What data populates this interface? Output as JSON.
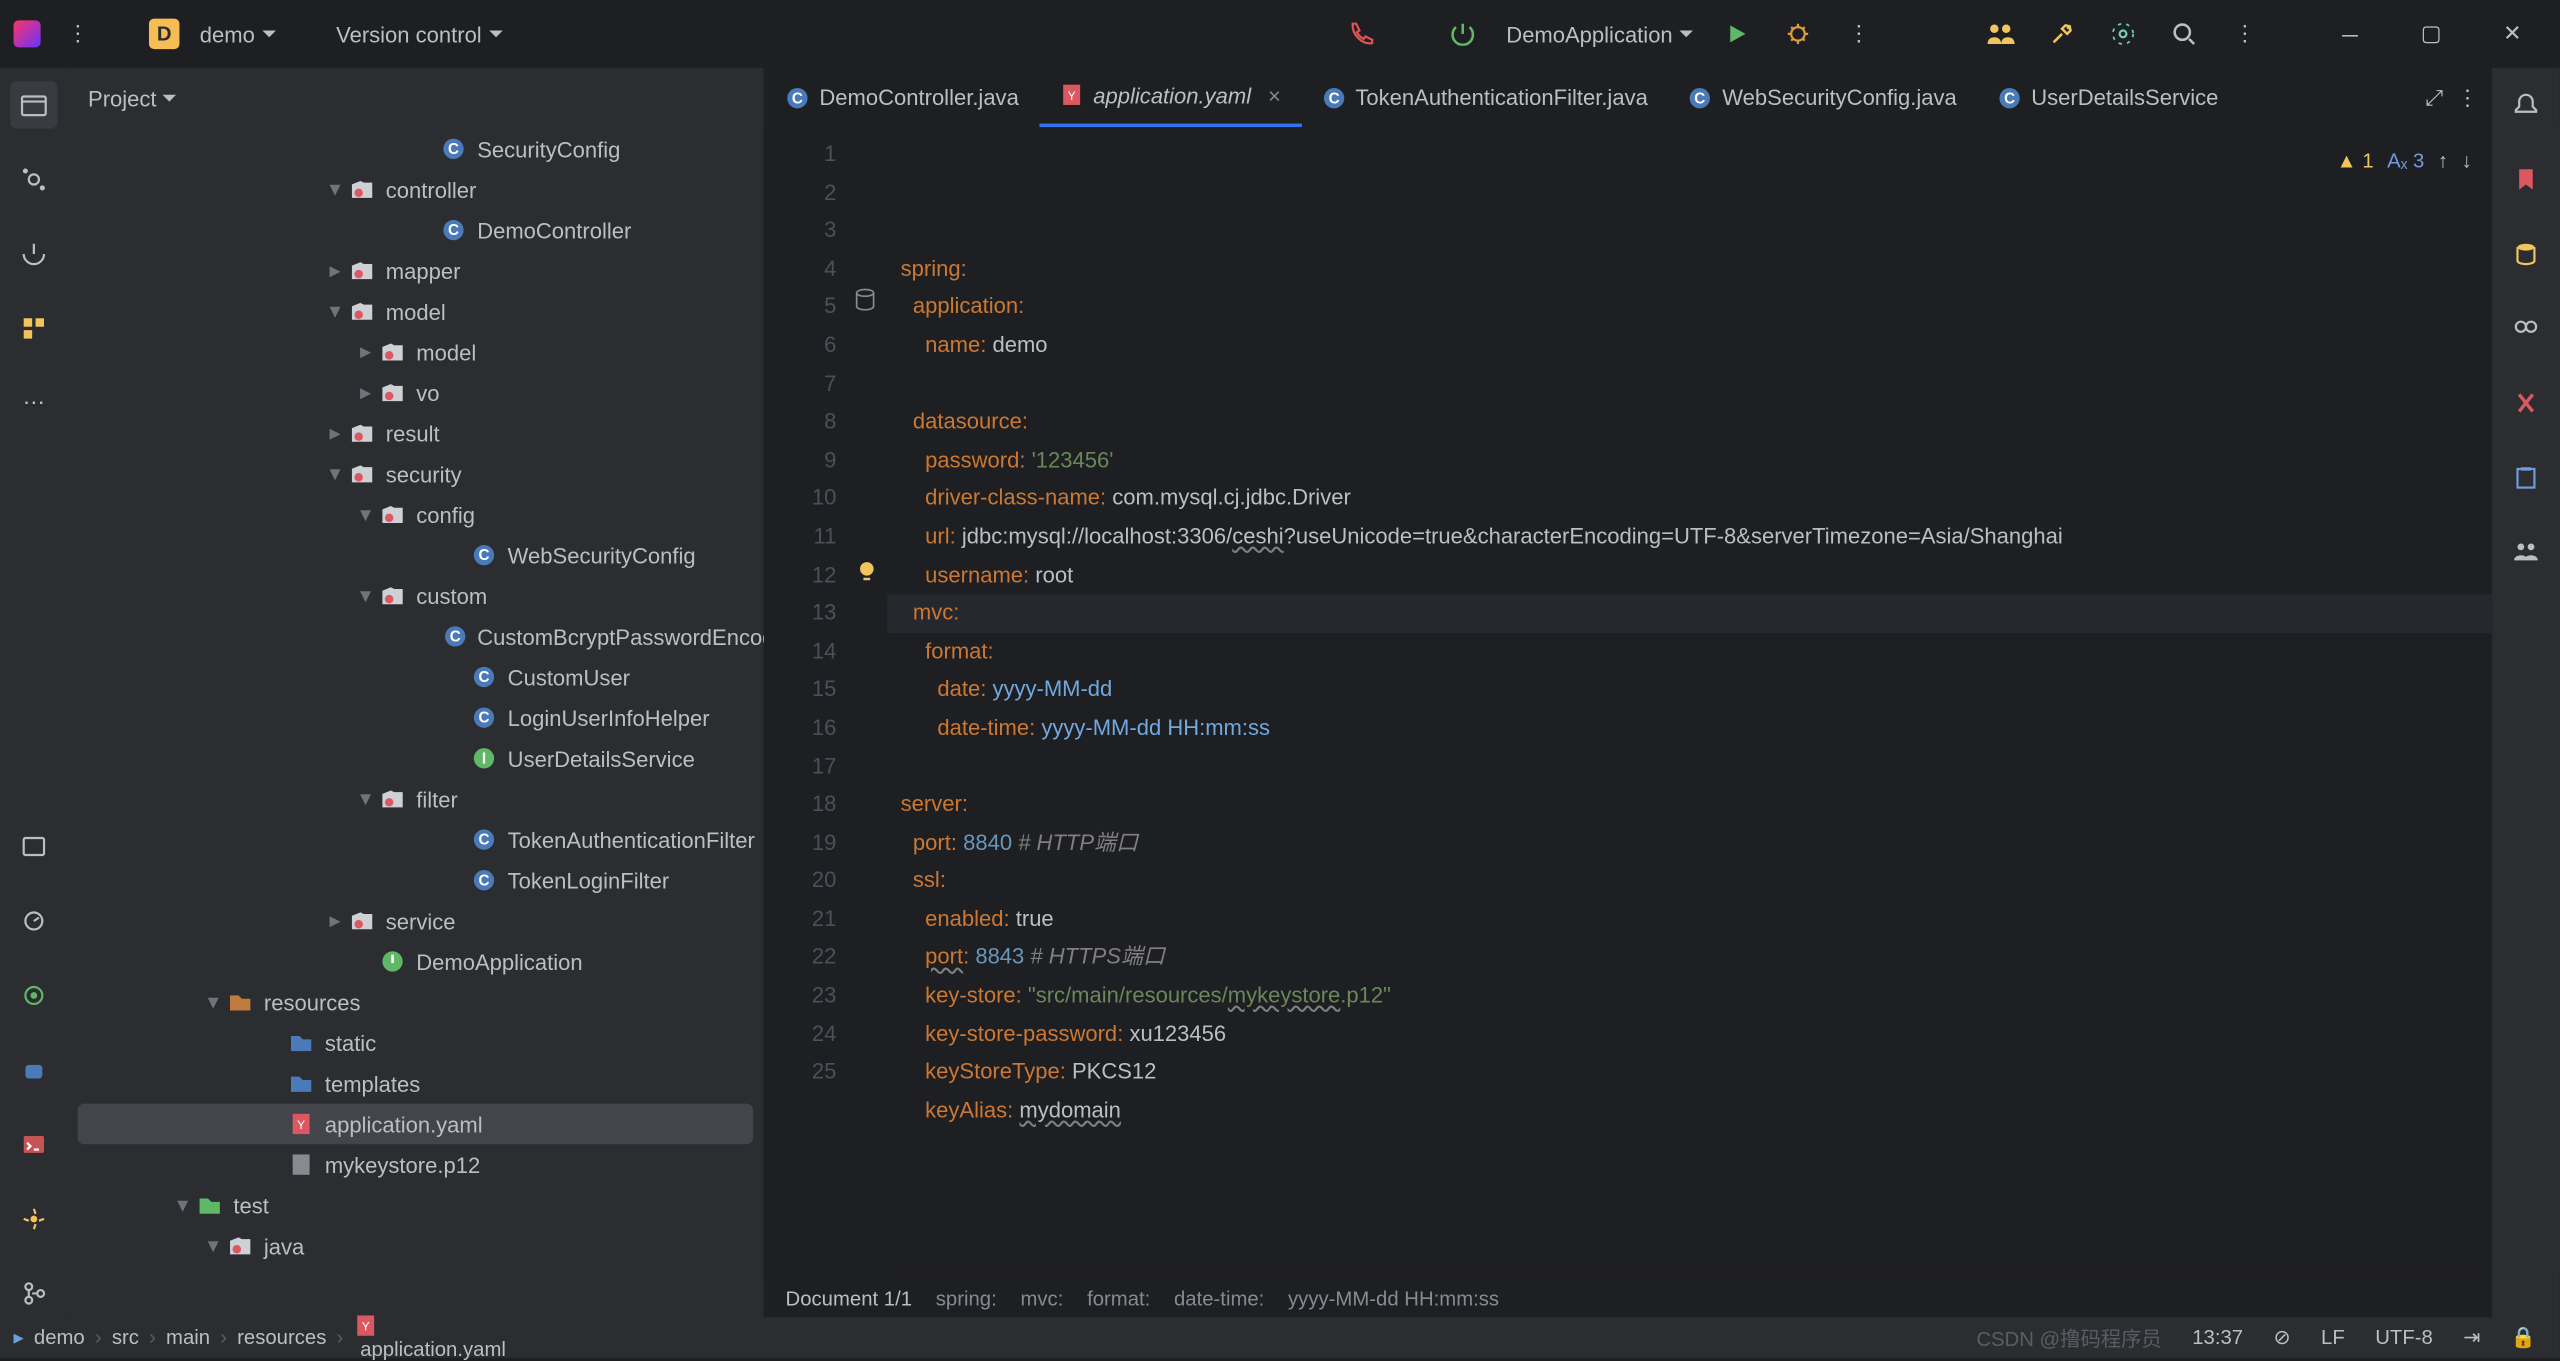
{
  "titlebar": {
    "project_badge": "D",
    "project_name": "demo",
    "vcs_label": "Version control",
    "run_config": "DemoApplication"
  },
  "sidebar": {
    "title": "Project",
    "items": [
      {
        "indent": 204,
        "arrow": "",
        "icon": "class",
        "label": "SecurityConfig"
      },
      {
        "indent": 150,
        "arrow": "▾",
        "icon": "pkg",
        "label": "controller"
      },
      {
        "indent": 204,
        "arrow": "",
        "icon": "class",
        "label": "DemoController"
      },
      {
        "indent": 150,
        "arrow": "▸",
        "icon": "pkg",
        "label": "mapper"
      },
      {
        "indent": 150,
        "arrow": "▾",
        "icon": "pkg",
        "label": "model"
      },
      {
        "indent": 168,
        "arrow": "▸",
        "icon": "pkg",
        "label": "model"
      },
      {
        "indent": 168,
        "arrow": "▸",
        "icon": "pkg",
        "label": "vo"
      },
      {
        "indent": 150,
        "arrow": "▸",
        "icon": "pkg",
        "label": "result"
      },
      {
        "indent": 150,
        "arrow": "▾",
        "icon": "pkg",
        "label": "security"
      },
      {
        "indent": 168,
        "arrow": "▾",
        "icon": "pkg",
        "label": "config"
      },
      {
        "indent": 222,
        "arrow": "",
        "icon": "class",
        "label": "WebSecurityConfig"
      },
      {
        "indent": 168,
        "arrow": "▾",
        "icon": "pkg",
        "label": "custom"
      },
      {
        "indent": 222,
        "arrow": "",
        "icon": "class",
        "label": "CustomBcryptPasswordEncoder"
      },
      {
        "indent": 222,
        "arrow": "",
        "icon": "class",
        "label": "CustomUser"
      },
      {
        "indent": 222,
        "arrow": "",
        "icon": "class",
        "label": "LoginUserInfoHelper"
      },
      {
        "indent": 222,
        "arrow": "",
        "icon": "interface",
        "label": "UserDetailsService"
      },
      {
        "indent": 168,
        "arrow": "▾",
        "icon": "pkg",
        "label": "filter"
      },
      {
        "indent": 222,
        "arrow": "",
        "icon": "class",
        "label": "TokenAuthenticationFilter"
      },
      {
        "indent": 222,
        "arrow": "",
        "icon": "class",
        "label": "TokenLoginFilter"
      },
      {
        "indent": 150,
        "arrow": "▸",
        "icon": "pkg",
        "label": "service"
      },
      {
        "indent": 168,
        "arrow": "",
        "icon": "springboot",
        "label": "DemoApplication"
      },
      {
        "indent": 78,
        "arrow": "▾",
        "icon": "res",
        "label": "resources"
      },
      {
        "indent": 114,
        "arrow": "",
        "icon": "folder",
        "label": "static"
      },
      {
        "indent": 114,
        "arrow": "",
        "icon": "folder",
        "label": "templates"
      },
      {
        "indent": 114,
        "arrow": "",
        "icon": "yaml",
        "label": "application.yaml",
        "selected": true
      },
      {
        "indent": 114,
        "arrow": "",
        "icon": "file",
        "label": "mykeystore.p12"
      },
      {
        "indent": 60,
        "arrow": "▾",
        "icon": "folder-test",
        "label": "test"
      },
      {
        "indent": 78,
        "arrow": "▾",
        "icon": "pkg",
        "label": "java"
      }
    ]
  },
  "tabs": [
    {
      "icon": "class",
      "label": "DemoController.java",
      "active": false
    },
    {
      "icon": "yaml",
      "label": "application.yaml",
      "active": true,
      "italic": true
    },
    {
      "icon": "class",
      "label": "TokenAuthenticationFilter.java",
      "active": false
    },
    {
      "icon": "class",
      "label": "WebSecurityConfig.java",
      "active": false
    },
    {
      "icon": "class",
      "label": "UserDetailsService",
      "active": false
    }
  ],
  "inspection": {
    "warnings": "1",
    "typos": "3"
  },
  "code": {
    "lines": [
      [
        {
          "t": "spring",
          "c": "k-key"
        },
        {
          "t": ":",
          "c": "k-key"
        }
      ],
      [
        {
          "t": "  "
        },
        {
          "t": "application",
          "c": "k-key"
        },
        {
          "t": ":",
          "c": "k-key"
        }
      ],
      [
        {
          "t": "    "
        },
        {
          "t": "name",
          "c": "k-key"
        },
        {
          "t": ": ",
          "c": "k-key"
        },
        {
          "t": "demo",
          "c": "k-val"
        }
      ],
      [],
      [
        {
          "t": "  "
        },
        {
          "t": "datasource",
          "c": "k-key"
        },
        {
          "t": ":",
          "c": "k-key"
        }
      ],
      [
        {
          "t": "    "
        },
        {
          "t": "password",
          "c": "k-key"
        },
        {
          "t": ": ",
          "c": "k-key"
        },
        {
          "t": "'123456'",
          "c": "k-str"
        }
      ],
      [
        {
          "t": "    "
        },
        {
          "t": "driver-class-name",
          "c": "k-key"
        },
        {
          "t": ": ",
          "c": "k-key"
        },
        {
          "t": "com.mysql.cj.jdbc.Driver",
          "c": "k-val"
        }
      ],
      [
        {
          "t": "    "
        },
        {
          "t": "url",
          "c": "k-key"
        },
        {
          "t": ": ",
          "c": "k-key"
        },
        {
          "t": "jdbc:mysql://localhost:3306/",
          "c": "k-val"
        },
        {
          "t": "ceshi",
          "c": "k-val k-wavy"
        },
        {
          "t": "?useUnicode=true&characterEncoding=UTF-8&serverTimezone=Asia/Shanghai",
          "c": "k-val"
        }
      ],
      [
        {
          "t": "    "
        },
        {
          "t": "username",
          "c": "k-key"
        },
        {
          "t": ": ",
          "c": "k-key"
        },
        {
          "t": "root",
          "c": "k-val"
        }
      ],
      [
        {
          "t": "  "
        },
        {
          "t": "mvc",
          "c": "k-key"
        },
        {
          "t": ":",
          "c": "k-key"
        }
      ],
      [
        {
          "t": "    "
        },
        {
          "t": "format",
          "c": "k-key"
        },
        {
          "t": ":",
          "c": "k-key"
        }
      ],
      [
        {
          "t": "      "
        },
        {
          "t": "date",
          "c": "k-key"
        },
        {
          "t": ": ",
          "c": "k-key"
        },
        {
          "t": "yyyy-MM-dd",
          "c": "k-ref"
        }
      ],
      [
        {
          "t": "      "
        },
        {
          "t": "date-time",
          "c": "k-key"
        },
        {
          "t": ": ",
          "c": "k-key"
        },
        {
          "t": "yyyy-MM-dd HH:mm:ss",
          "c": "k-ref"
        }
      ],
      [],
      [
        {
          "t": "server",
          "c": "k-key"
        },
        {
          "t": ":",
          "c": "k-key"
        }
      ],
      [
        {
          "t": "  "
        },
        {
          "t": "port",
          "c": "k-key"
        },
        {
          "t": ": ",
          "c": "k-key"
        },
        {
          "t": "8840",
          "c": "k-num"
        },
        {
          "t": " "
        },
        {
          "t": "# HTTP端口",
          "c": "k-cmt"
        }
      ],
      [
        {
          "t": "  "
        },
        {
          "t": "ssl",
          "c": "k-key"
        },
        {
          "t": ":",
          "c": "k-key"
        }
      ],
      [
        {
          "t": "    "
        },
        {
          "t": "enabled",
          "c": "k-key"
        },
        {
          "t": ": ",
          "c": "k-key"
        },
        {
          "t": "true",
          "c": "k-val"
        }
      ],
      [
        {
          "t": "    "
        },
        {
          "t": "port",
          "c": "k-key k-wavy"
        },
        {
          "t": ": ",
          "c": "k-key"
        },
        {
          "t": "8843",
          "c": "k-num"
        },
        {
          "t": " "
        },
        {
          "t": "# HTTPS端口",
          "c": "k-cmt"
        }
      ],
      [
        {
          "t": "    "
        },
        {
          "t": "key-store",
          "c": "k-key"
        },
        {
          "t": ": ",
          "c": "k-key"
        },
        {
          "t": "\"src/main/resources/",
          "c": "k-str"
        },
        {
          "t": "mykeystore",
          "c": "k-str k-wavy"
        },
        {
          "t": ".p12\"",
          "c": "k-str"
        }
      ],
      [
        {
          "t": "    "
        },
        {
          "t": "key-store-password",
          "c": "k-key"
        },
        {
          "t": ": ",
          "c": "k-key"
        },
        {
          "t": "xu123456",
          "c": "k-val"
        }
      ],
      [
        {
          "t": "    "
        },
        {
          "t": "keyStoreType",
          "c": "k-key"
        },
        {
          "t": ": ",
          "c": "k-key"
        },
        {
          "t": "PKCS12",
          "c": "k-val"
        }
      ],
      [
        {
          "t": "    "
        },
        {
          "t": "keyAlias",
          "c": "k-key"
        },
        {
          "t": ": ",
          "c": "k-key"
        },
        {
          "t": "mydomain",
          "c": "k-val k-wavy"
        }
      ],
      [],
      []
    ],
    "highlight_line": 13,
    "lightbulb_line": 12,
    "db_gutter_line": 5
  },
  "breadcrumb_editor": {
    "doc": "Document 1/1",
    "path": [
      "spring:",
      "mvc:",
      "format:",
      "date-time:",
      "yyyy-MM-dd HH:mm:ss"
    ]
  },
  "nav_path": [
    "demo",
    "src",
    "main",
    "resources",
    "application.yaml"
  ],
  "status": {
    "time": "13:37",
    "line_ending": "LF",
    "encoding": "UTF-8",
    "indent": ""
  },
  "watermark": "CSDN @撸码程序员"
}
